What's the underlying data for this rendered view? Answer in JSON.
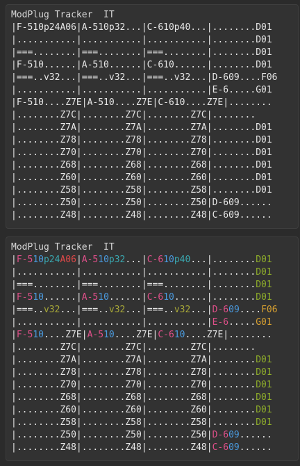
{
  "panels": [
    {
      "id": "plain",
      "title": "ModPlug Tracker  IT",
      "rows": [
        [
          [
            "|F-510p24A06|A-510p32...|C-610p40...|........D01",
            "w"
          ]
        ],
        [
          [
            "|...........|...........|...........|........D01",
            "w"
          ]
        ],
        [
          [
            "|===........|===........|===........|........D01",
            "w"
          ]
        ],
        [
          [
            "|F-510......|A-510......|C-610......|........D01",
            "w"
          ]
        ],
        [
          [
            "|===..v32...|===..v32...|===..v32...|D-609....F06",
            "w"
          ]
        ],
        [
          [
            "|...........|...........|...........|E-6.....G01",
            "w"
          ]
        ],
        [
          [
            "|F-510....Z7E|A-510....Z7E|C-610....Z7E|........",
            "w"
          ]
        ],
        [
          [
            "|........Z7C|........Z7C|........Z7C|........",
            "w"
          ]
        ],
        [
          [
            "|........Z7A|........Z7A|........Z7A|........D01",
            "w"
          ]
        ],
        [
          [
            "|........Z78|........Z78|........Z78|........D01",
            "w"
          ]
        ],
        [
          [
            "|........Z70|........Z70|........Z70|........D01",
            "w"
          ]
        ],
        [
          [
            "|........Z68|........Z68|........Z68|........D01",
            "w"
          ]
        ],
        [
          [
            "|........Z60|........Z60|........Z60|........D01",
            "w"
          ]
        ],
        [
          [
            "|........Z58|........Z58|........Z58|........D01",
            "w"
          ]
        ],
        [
          [
            "|........Z50|........Z50|........Z50|D-609......",
            "w"
          ]
        ],
        [
          [
            "|........Z48|........Z48|........Z48|C-609......",
            "w"
          ]
        ]
      ]
    },
    {
      "id": "color",
      "title": "ModPlug Tracker  IT",
      "rows": [
        [
          [
            "|",
            "w"
          ],
          [
            "F-5",
            "pink"
          ],
          [
            "10",
            "blue"
          ],
          [
            "p24",
            "teal"
          ],
          [
            "A06",
            "red"
          ],
          [
            "|",
            "w"
          ],
          [
            "A-5",
            "pink"
          ],
          [
            "10",
            "blue"
          ],
          [
            "p32",
            "teal"
          ],
          [
            "...",
            "w"
          ],
          [
            "|",
            "w"
          ],
          [
            "C-6",
            "pink"
          ],
          [
            "10",
            "blue"
          ],
          [
            "p40",
            "teal"
          ],
          [
            "...",
            "w"
          ],
          [
            "|........",
            "w"
          ],
          [
            "D01",
            "green"
          ]
        ],
        [
          [
            "|...........|...........|...........|........",
            "w"
          ],
          [
            "D01",
            "green"
          ]
        ],
        [
          [
            "|===........|===........|===........|........",
            "w"
          ],
          [
            "D01",
            "green"
          ]
        ],
        [
          [
            "|",
            "w"
          ],
          [
            "F-5",
            "pink"
          ],
          [
            "10",
            "blue"
          ],
          [
            "......|",
            "w"
          ],
          [
            "A-5",
            "pink"
          ],
          [
            "10",
            "blue"
          ],
          [
            "......|",
            "w"
          ],
          [
            "C-6",
            "pink"
          ],
          [
            "10",
            "blue"
          ],
          [
            "......|........",
            "w"
          ],
          [
            "D01",
            "green"
          ]
        ],
        [
          [
            "|===..",
            "w"
          ],
          [
            "v32",
            "olive"
          ],
          [
            "...|===..",
            "w"
          ],
          [
            "v32",
            "olive"
          ],
          [
            "...|===..",
            "w"
          ],
          [
            "v32",
            "olive"
          ],
          [
            "...|",
            "w"
          ],
          [
            "D-6",
            "pink"
          ],
          [
            "09",
            "blue"
          ],
          [
            "....",
            "w"
          ],
          [
            "F06",
            "orange"
          ]
        ],
        [
          [
            "|...........|...........|...........|",
            "w"
          ],
          [
            "E-6",
            "pink"
          ],
          [
            ".....",
            "w"
          ],
          [
            "G01",
            "orange"
          ]
        ],
        [
          [
            "|",
            "w"
          ],
          [
            "F-5",
            "pink"
          ],
          [
            "10",
            "blue"
          ],
          [
            "....Z7E|",
            "w"
          ],
          [
            "A-5",
            "pink"
          ],
          [
            "10",
            "blue"
          ],
          [
            "....Z7E|",
            "w"
          ],
          [
            "C-6",
            "pink"
          ],
          [
            "10",
            "blue"
          ],
          [
            "....Z7E|........",
            "w"
          ]
        ],
        [
          [
            "|........Z7C|........Z7C|........Z7C|........",
            "w"
          ]
        ],
        [
          [
            "|........Z7A|........Z7A|........Z7A|........",
            "w"
          ],
          [
            "D01",
            "green"
          ]
        ],
        [
          [
            "|........Z78|........Z78|........Z78|........",
            "w"
          ],
          [
            "D01",
            "green"
          ]
        ],
        [
          [
            "|........Z70|........Z70|........Z70|........",
            "w"
          ],
          [
            "D01",
            "green"
          ]
        ],
        [
          [
            "|........Z68|........Z68|........Z68|........",
            "w"
          ],
          [
            "D01",
            "green"
          ]
        ],
        [
          [
            "|........Z60|........Z60|........Z60|........",
            "w"
          ],
          [
            "D01",
            "green"
          ]
        ],
        [
          [
            "|........Z58|........Z58|........Z58|........",
            "w"
          ],
          [
            "D01",
            "green"
          ]
        ],
        [
          [
            "|........Z50|........Z50|........Z50|",
            "w"
          ],
          [
            "D-6",
            "pink"
          ],
          [
            "09",
            "blue"
          ],
          [
            "......",
            "w"
          ]
        ],
        [
          [
            "|........Z48|........Z48|........Z48|",
            "w"
          ],
          [
            "C-6",
            "pink"
          ],
          [
            "09",
            "blue"
          ],
          [
            "......",
            "w"
          ]
        ]
      ]
    }
  ],
  "colors": {
    "w": "#e6e6e6",
    "pink": "#e0508a",
    "blue": "#4a9be0",
    "teal": "#3aa8b0",
    "red": "#e04848",
    "green": "#8fae2a",
    "olive": "#a8a838",
    "orange": "#d8a030"
  }
}
